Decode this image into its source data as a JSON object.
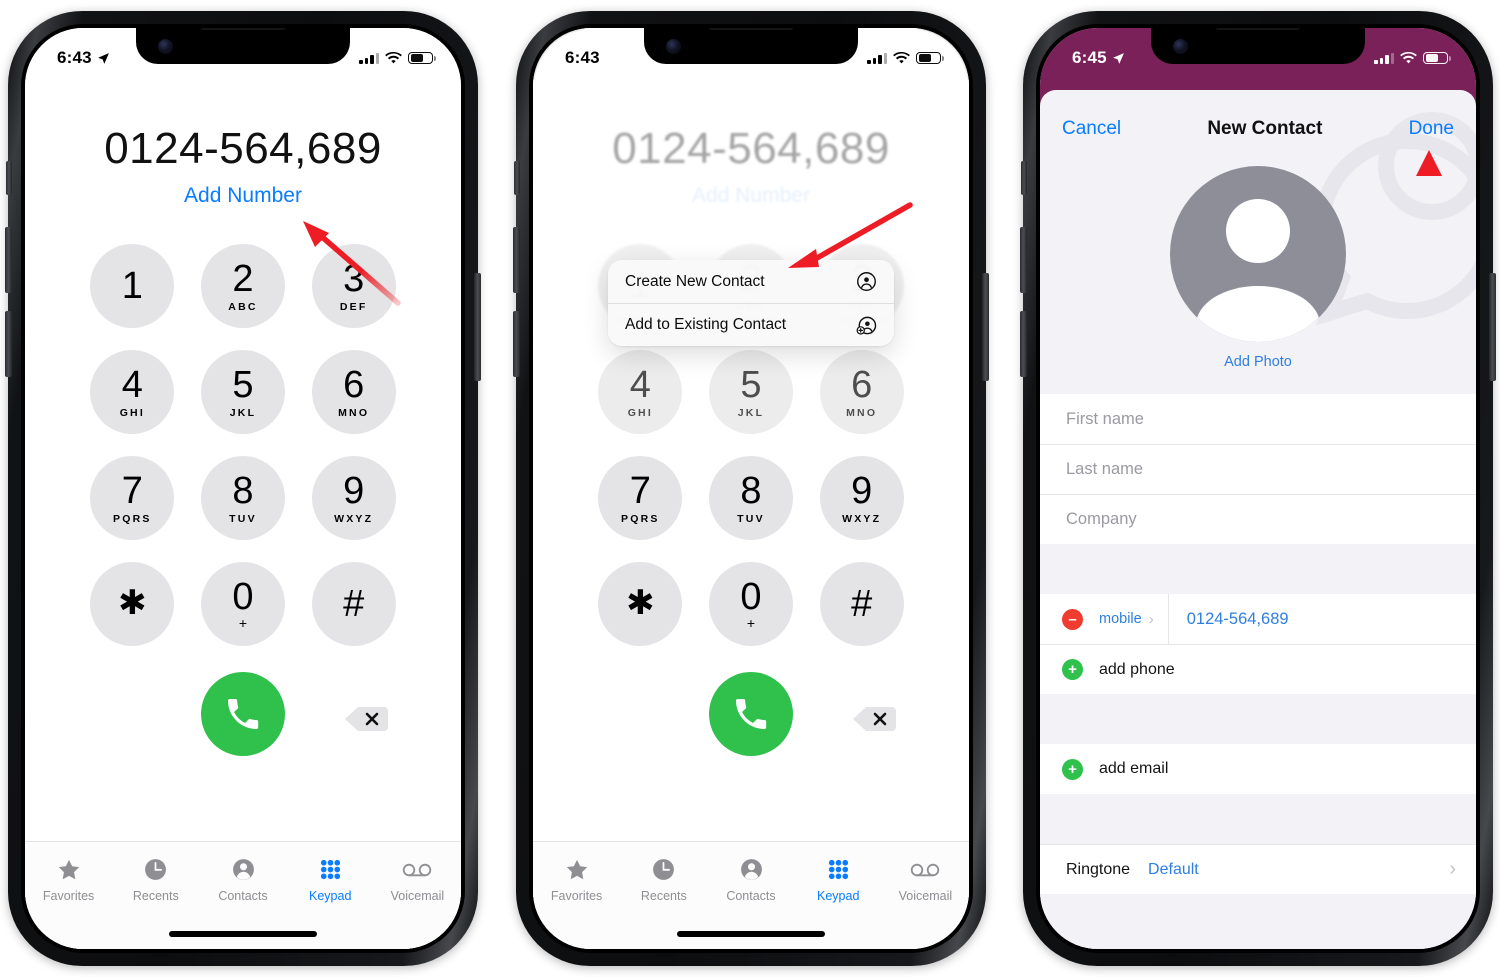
{
  "phones": [
    {
      "id": "phone-keypad",
      "status": {
        "time": "6:43",
        "location_icon": "location-arrow-icon",
        "signal_icon": "cellular-signal-icon",
        "wifi_icon": "wifi-icon",
        "battery_icon": "battery-icon"
      },
      "dialer": {
        "number": "0124-564,689",
        "add_number_label": "Add Number"
      },
      "keys": [
        {
          "digit": "1",
          "letters": ""
        },
        {
          "digit": "2",
          "letters": "ABC"
        },
        {
          "digit": "3",
          "letters": "DEF"
        },
        {
          "digit": "4",
          "letters": "GHI"
        },
        {
          "digit": "5",
          "letters": "JKL"
        },
        {
          "digit": "6",
          "letters": "MNO"
        },
        {
          "digit": "7",
          "letters": "PQRS"
        },
        {
          "digit": "8",
          "letters": "TUV"
        },
        {
          "digit": "9",
          "letters": "WXYZ"
        },
        {
          "digit": "✱",
          "letters": ""
        },
        {
          "digit": "0",
          "letters": "+"
        },
        {
          "digit": "#",
          "letters": ""
        }
      ],
      "call_button_icon": "phone-call-icon",
      "delete_button_icon": "delete-backspace-icon",
      "tabs": [
        {
          "label": "Favorites",
          "icon": "star-icon",
          "active": false
        },
        {
          "label": "Recents",
          "icon": "clock-icon",
          "active": false
        },
        {
          "label": "Contacts",
          "icon": "person-circle-icon",
          "active": false
        },
        {
          "label": "Keypad",
          "icon": "keypad-grid-icon",
          "active": true
        },
        {
          "label": "Voicemail",
          "icon": "voicemail-icon",
          "active": false
        }
      ]
    },
    {
      "id": "phone-context-menu",
      "status": {
        "time": "6:43",
        "signal_icon": "cellular-signal-icon",
        "wifi_icon": "wifi-icon",
        "battery_icon": "battery-icon"
      },
      "menu": [
        {
          "label": "Create New Contact",
          "icon": "person-circle-icon"
        },
        {
          "label": "Add to Existing Contact",
          "icon": "person-add-icon"
        }
      ]
    },
    {
      "id": "phone-new-contact",
      "status": {
        "time": "6:45",
        "location_icon": "location-arrow-icon",
        "signal_icon": "cellular-signal-icon",
        "wifi_icon": "wifi-icon",
        "battery_icon": "battery-icon"
      },
      "nav": {
        "cancel": "Cancel",
        "title": "New Contact",
        "done": "Done"
      },
      "photo": {
        "add_photo_label": "Add Photo",
        "avatar_icon": "person-avatar-icon"
      },
      "name_fields": [
        {
          "placeholder": "First name",
          "value": ""
        },
        {
          "placeholder": "Last name",
          "value": ""
        },
        {
          "placeholder": "Company",
          "value": ""
        }
      ],
      "phone_rows": [
        {
          "remove_icon": "minus-circle-icon",
          "type_label": "mobile",
          "chevron_icon": "chevron-right-icon",
          "value": "0124-564,689"
        }
      ],
      "add_phone": {
        "icon": "plus-circle-icon",
        "label": "add phone"
      },
      "add_email": {
        "icon": "plus-circle-icon",
        "label": "add email"
      },
      "ringtone": {
        "key": "Ringtone",
        "value": "Default",
        "chevron_icon": "chevron-right-icon"
      }
    }
  ],
  "annotations": {
    "arrow_color": "#EE1C25",
    "arrows": [
      {
        "name": "arrow-to-add-number",
        "target": "Add Number"
      },
      {
        "name": "arrow-to-create-new-contact",
        "target": "Create New Contact"
      },
      {
        "name": "arrow-to-done",
        "target": "Done"
      }
    ]
  },
  "theme": {
    "ios_blue": "#0A7CFF",
    "ios_green": "#2FC14C",
    "ios_red": "#F03B2F",
    "status_purple": "#7A2159",
    "key_gray": "#E4E4E6"
  }
}
